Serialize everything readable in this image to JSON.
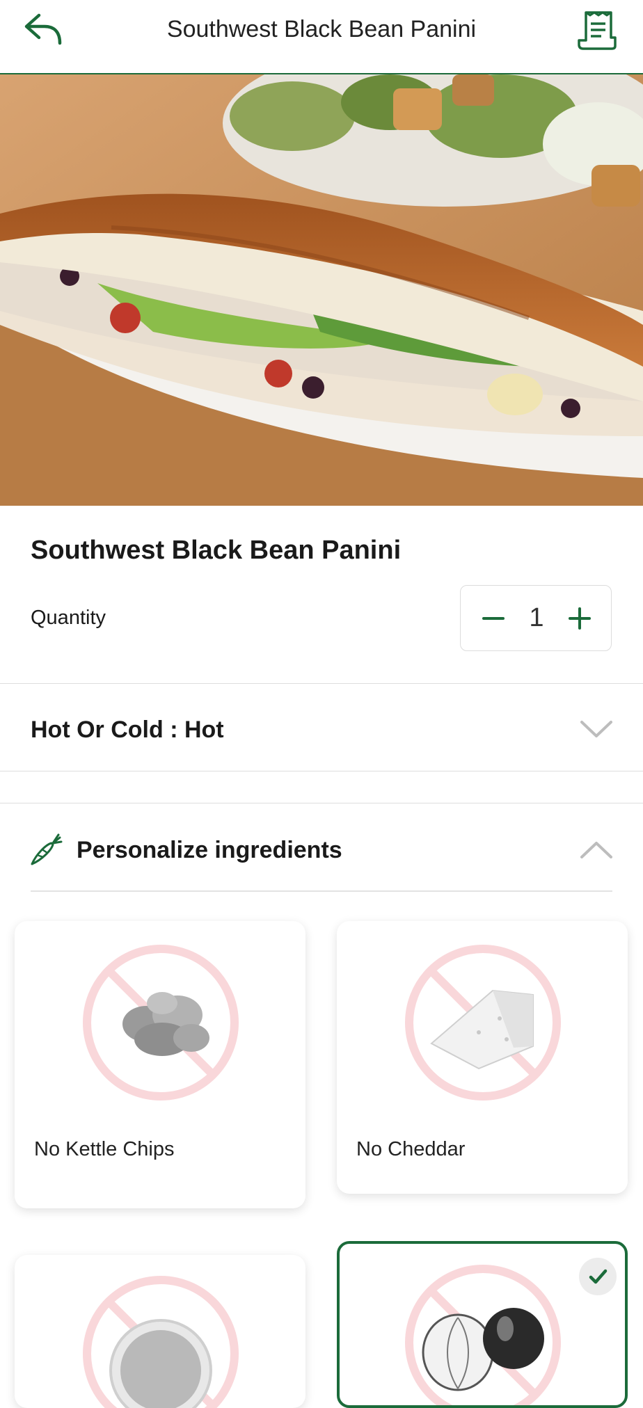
{
  "header": {
    "title": "Southwest Black Bean Panini",
    "back_icon": "back-arrow-icon",
    "receipt_icon": "receipt-icon"
  },
  "product": {
    "name": "Southwest Black Bean Panini",
    "quantity_label": "Quantity",
    "quantity": "1"
  },
  "options": {
    "hot_or_cold": "Hot Or Cold : Hot"
  },
  "personalize": {
    "title": "Personalize ingredients",
    "items": [
      {
        "label": "No Kettle Chips",
        "selected": false
      },
      {
        "label": "No Cheddar",
        "selected": false
      },
      {
        "label": "",
        "selected": false
      },
      {
        "label": "",
        "selected": true
      }
    ]
  },
  "colors": {
    "brand_green": "#1b6b3a",
    "no_symbol_pink": "#f9d7da"
  }
}
